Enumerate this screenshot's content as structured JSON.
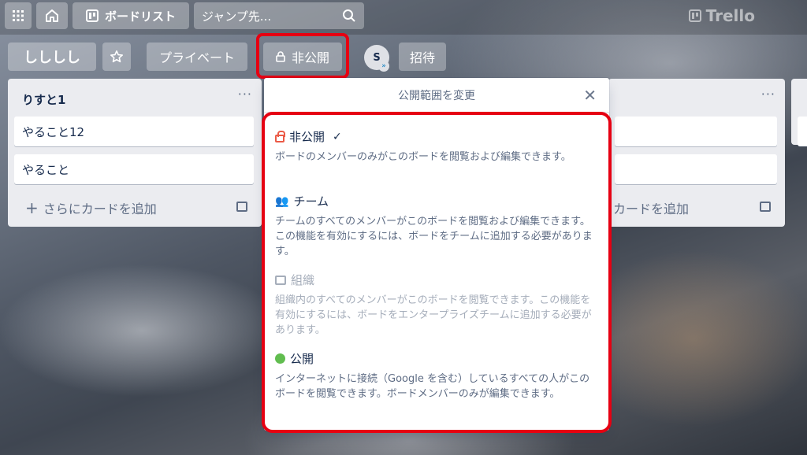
{
  "topbar": {
    "boards_label": "ボードリスト",
    "search_placeholder": "ジャンプ先...",
    "logo": "Trello"
  },
  "board_header": {
    "board_name": "しししし",
    "privacy_label": "プライベート",
    "visibility_label": "非公開",
    "avatar_initial": "S",
    "invite_label": "招待"
  },
  "lists": [
    {
      "title": "りすと1",
      "cards": [
        "やること12",
        "やること"
      ],
      "add_card_label": "さらにカードを追加"
    },
    {
      "add_card_label": "カードを追加"
    }
  ],
  "popover": {
    "title": "公開範囲を変更",
    "options": [
      {
        "title": "非公開",
        "selected": true,
        "desc": "ボードのメンバーのみがこのボードを閲覧および編集できます。"
      },
      {
        "title": "チーム",
        "desc": "チームのすべてのメンバーがこのボードを閲覧および編集できます。この機能を有効にするには、ボードをチームに追加する必要があります。"
      },
      {
        "title": "組織",
        "disabled": true,
        "desc": "組織内のすべてのメンバーがこのボードを閲覧できます。この機能を有効にするには、ボードをエンタープライズチームに追加する必要があります。"
      },
      {
        "title": "公開",
        "desc": "インターネットに接続（Google を含む）しているすべての人がこのボードを閲覧できます。ボードメンバーのみが編集できます。"
      }
    ]
  },
  "colors": {
    "highlight": "#e60012",
    "private_icon": "#eb5a46",
    "public_icon": "#61bd4f"
  }
}
